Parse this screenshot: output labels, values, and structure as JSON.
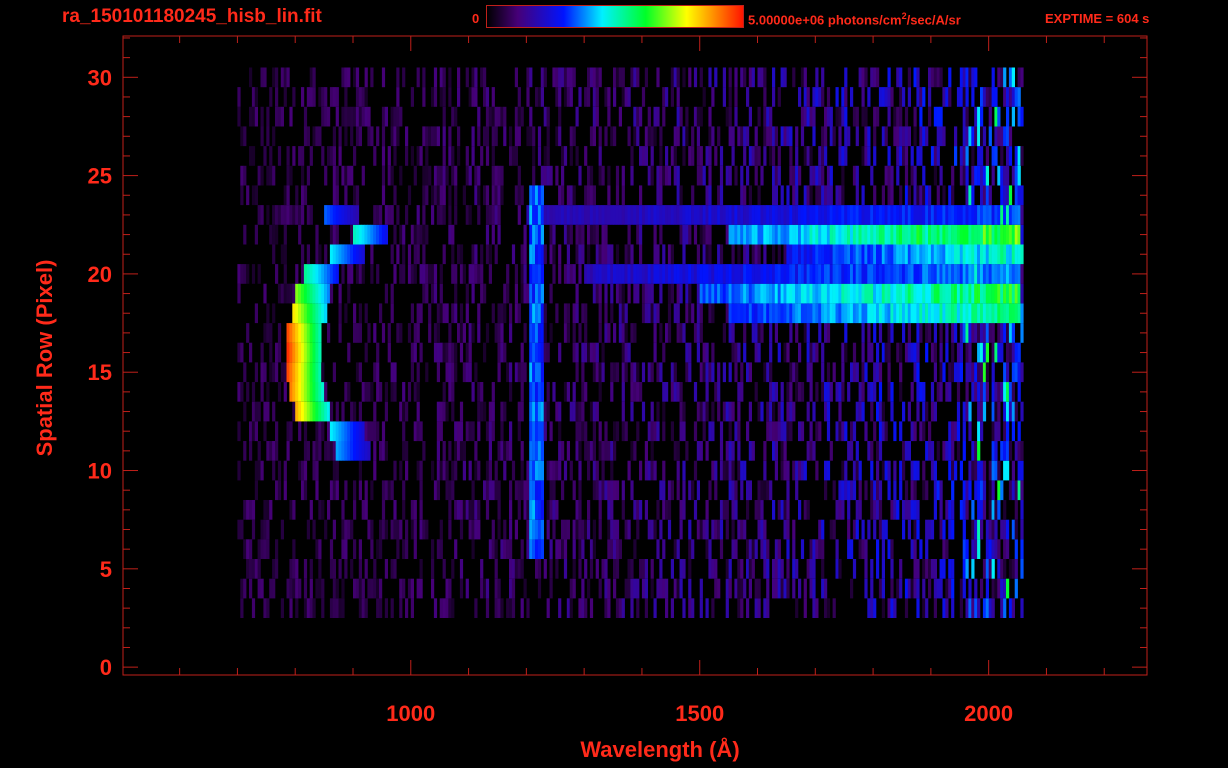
{
  "header": {
    "title": "ra_150101180245_hisb_lin.fit",
    "colorbar_min": "0",
    "colorbar_max_prefix": "5.00000e+06 photons/cm",
    "colorbar_max_sup": "2",
    "colorbar_max_suffix": "/sec/A/sr",
    "exptime": "EXPTIME = 604 s"
  },
  "colors": {
    "axis": "#ff2a1a",
    "frame": "#c0201a",
    "background": "#000000"
  },
  "chart_data": {
    "type": "heatmap",
    "title": "ra_150101180245_hisb_lin.fit",
    "xlabel": "Wavelength (Å)",
    "ylabel": "Spatial Row (Pixel)",
    "xlim": [
      502,
      2274
    ],
    "ylim": [
      -0.4,
      32.1
    ],
    "xticks": [
      1000,
      1500,
      2000
    ],
    "xtick_labels": [
      "1000",
      "1500",
      "2000"
    ],
    "xminor_step": 100,
    "yticks": [
      0,
      5,
      10,
      15,
      20,
      25,
      30
    ],
    "ytick_labels": [
      "0",
      "5",
      "10",
      "15",
      "20",
      "25",
      "30"
    ],
    "yminor_step": 1,
    "colorbar": {
      "min": 0,
      "max": 5000000,
      "units": "photons/cm^2/sec/A/sr",
      "colormap": "rainbow"
    },
    "data_extent": {
      "rows": [
        3,
        30
      ],
      "wavelength": [
        700,
        2060
      ],
      "bin_width": 5
    },
    "features": [
      {
        "name": "bright-band",
        "row": 22,
        "from": 1550,
        "to": 2050,
        "level": 0.6
      },
      {
        "name": "bright-band",
        "row": 19,
        "from": 1500,
        "to": 2050,
        "level": 0.55
      },
      {
        "name": "bright-band",
        "row": 18,
        "from": 1550,
        "to": 2050,
        "level": 0.5
      },
      {
        "name": "faint-band",
        "row": 23,
        "from": 1200,
        "to": 2050,
        "level": 0.3
      },
      {
        "name": "faint-band",
        "row": 21,
        "from": 1650,
        "to": 2060,
        "level": 0.45
      },
      {
        "name": "faint-band",
        "row": 20,
        "from": 1300,
        "to": 2050,
        "level": 0.35
      },
      {
        "name": "lyman-alpha",
        "wavelength": 1216,
        "rows": [
          6,
          24
        ],
        "level": 0.35
      },
      {
        "name": "arc",
        "points": [
          [
            11,
            870,
            0.4
          ],
          [
            12,
            860,
            0.45
          ],
          [
            13,
            800,
            0.85
          ],
          [
            14,
            790,
            0.9
          ],
          [
            15,
            785,
            0.95
          ],
          [
            16,
            782,
            1.0
          ],
          [
            17,
            785,
            0.95
          ],
          [
            18,
            795,
            0.8
          ],
          [
            19,
            800,
            0.7
          ],
          [
            20,
            812,
            0.55
          ],
          [
            21,
            860,
            0.45
          ],
          [
            22,
            900,
            0.5
          ],
          [
            23,
            850,
            0.35
          ]
        ]
      }
    ]
  }
}
